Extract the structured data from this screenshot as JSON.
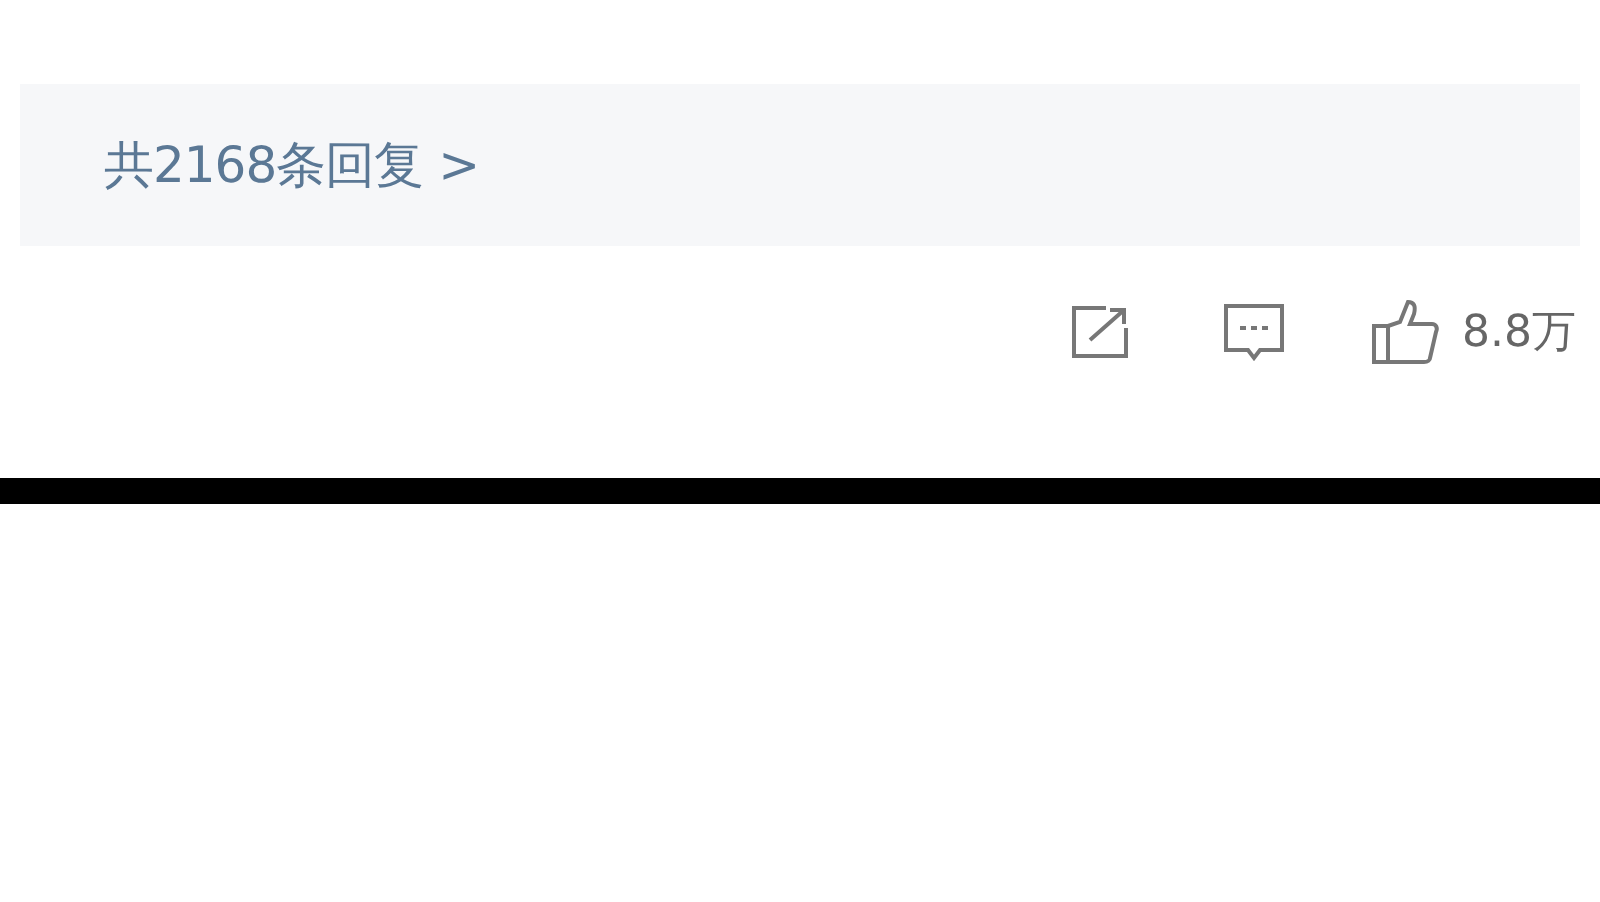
{
  "replies": {
    "link": "共2168条回复 >"
  },
  "actions": {
    "likes": "8.8万"
  }
}
